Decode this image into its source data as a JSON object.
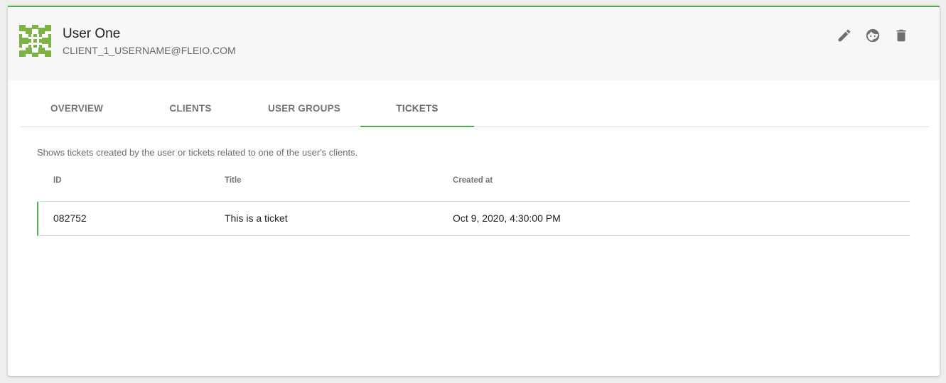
{
  "user": {
    "name": "User One",
    "email": "CLIENT_1_USERNAME@FLEIO.COM"
  },
  "actions": {
    "icons": [
      "pencil-icon",
      "face-icon",
      "trash-icon"
    ]
  },
  "tabs": [
    {
      "label": "OVERVIEW",
      "active": false
    },
    {
      "label": "CLIENTS",
      "active": false
    },
    {
      "label": "USER GROUPS",
      "active": false
    },
    {
      "label": "TICKETS",
      "active": true
    }
  ],
  "tickets": {
    "description": "Shows tickets created by the user or tickets related to one of the user's clients.",
    "columns": [
      "ID",
      "Title",
      "Created at"
    ],
    "rows": [
      {
        "id": "082752",
        "title": "This is a ticket",
        "created_at": "Oct 9, 2020, 4:30:00 PM"
      }
    ]
  },
  "colors": {
    "accent": "#4caf50",
    "avatar_green": "#7cb342",
    "header_bg": "#f7f7f7"
  }
}
